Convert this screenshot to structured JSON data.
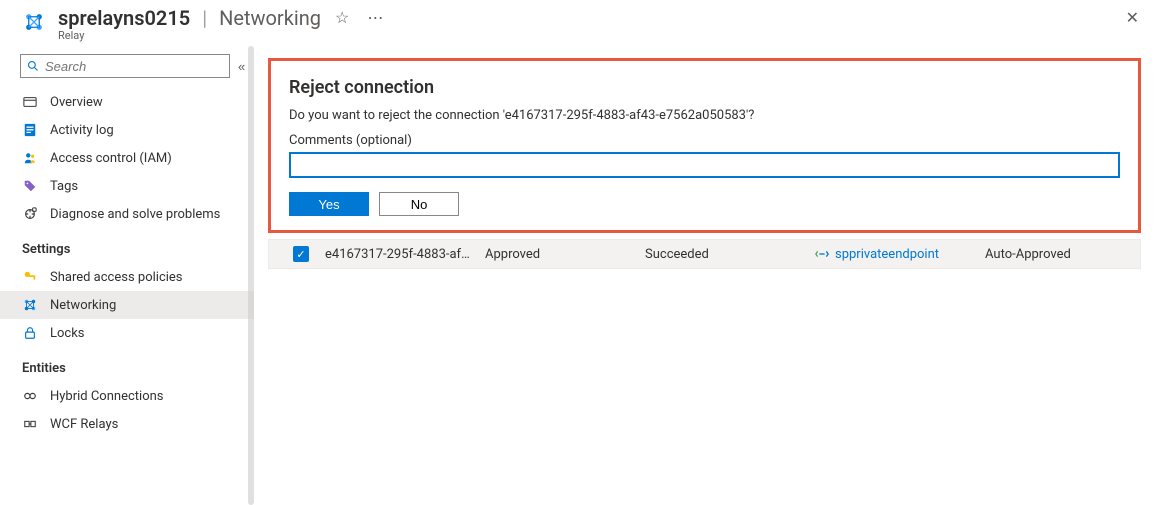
{
  "header": {
    "resource_name": "sprelayns0215",
    "page_name": "Networking",
    "subtitle": "Relay"
  },
  "sidebar": {
    "search_placeholder": "Search",
    "items": [
      {
        "label": "Overview",
        "icon": "overview-icon"
      },
      {
        "label": "Activity log",
        "icon": "activity-log-icon"
      },
      {
        "label": "Access control (IAM)",
        "icon": "access-control-icon"
      },
      {
        "label": "Tags",
        "icon": "tags-icon"
      },
      {
        "label": "Diagnose and solve problems",
        "icon": "diagnose-icon"
      }
    ],
    "groups": [
      {
        "title": "Settings",
        "items": [
          {
            "label": "Shared access policies",
            "icon": "key-icon"
          },
          {
            "label": "Networking",
            "icon": "networking-icon",
            "active": true
          },
          {
            "label": "Locks",
            "icon": "lock-icon"
          }
        ]
      },
      {
        "title": "Entities",
        "items": [
          {
            "label": "Hybrid Connections",
            "icon": "hybrid-icon"
          },
          {
            "label": "WCF Relays",
            "icon": "wcf-icon"
          }
        ]
      }
    ]
  },
  "dialog": {
    "title": "Reject connection",
    "message": "Do you want to reject the connection 'e4167317-295f-4883-af43-e7562a050583'?",
    "comments_label": "Comments (optional)",
    "comments_value": "",
    "yes_label": "Yes",
    "no_label": "No"
  },
  "grid": {
    "rows": [
      {
        "checked": true,
        "name": "e4167317-295f-4883-af4…",
        "connection_state": "Approved",
        "provisioning_state": "Succeeded",
        "private_endpoint": "spprivateendpoint",
        "description": "Auto-Approved"
      }
    ]
  }
}
